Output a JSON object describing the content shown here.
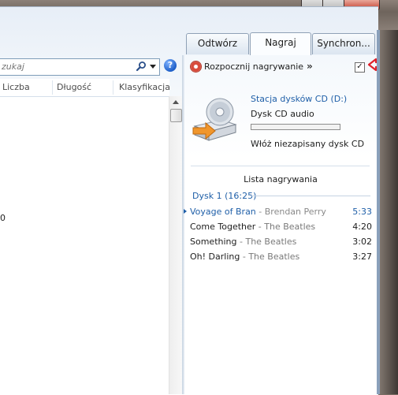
{
  "tabs": [
    {
      "label": "Odtwórz",
      "active": false
    },
    {
      "label": "Nagraj",
      "active": true
    },
    {
      "label": "Synchron...",
      "active": false
    }
  ],
  "search": {
    "placeholder": "zukaj"
  },
  "columns": [
    "Liczba",
    "Długość",
    "Klasyfikacja"
  ],
  "library": {
    "partial_value": "0"
  },
  "burn_toolbar": {
    "start_label": "Rozpocznij nagrywanie",
    "more_label": "»",
    "options_label": "✓"
  },
  "drive": {
    "name": "Stacja dysków CD (D:)",
    "type": "Dysk CD audio",
    "progress_percent": 0,
    "message": "Włóż niezapisany dysk CD"
  },
  "burn_list": {
    "title": "Lista nagrywania",
    "disc_header": "Dysk 1 (16:25)",
    "tracks": [
      {
        "title": "Voyage of Bran",
        "artist": "Brendan Perry",
        "separator": " - ",
        "duration": "5:33",
        "playing": true
      },
      {
        "title": "Come Together",
        "artist": "The Beatles",
        "separator": " - ",
        "duration": "4:20",
        "playing": false
      },
      {
        "title": "Something",
        "artist": "The Beatles",
        "separator": " - ",
        "duration": "3:02",
        "playing": false
      },
      {
        "title": "Oh! Darling",
        "artist": "The Beatles",
        "separator": " - ",
        "duration": "3:27",
        "playing": false
      }
    ]
  },
  "colors": {
    "accent": "#1f5fa8",
    "progress": "#3bb34a",
    "annotation_arrow": "#e0202a"
  }
}
